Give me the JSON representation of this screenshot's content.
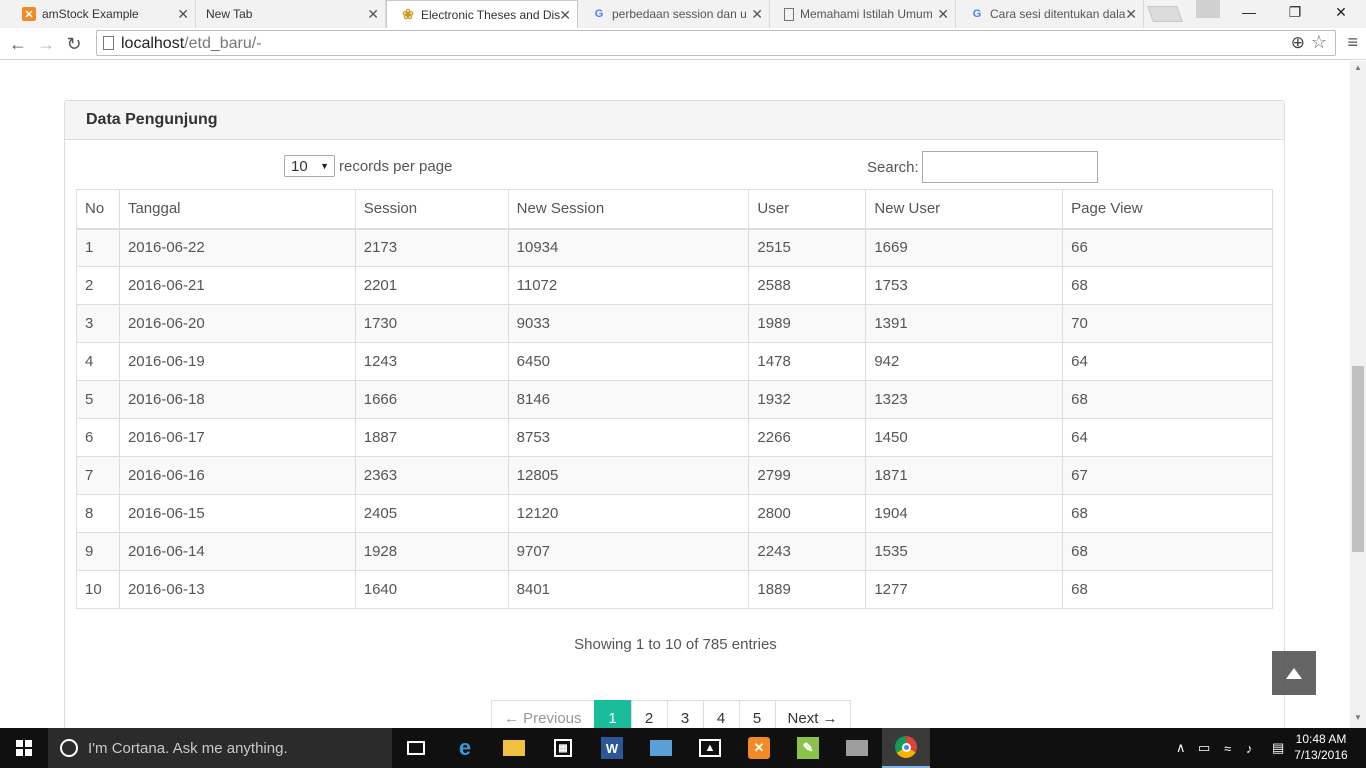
{
  "browser": {
    "tabs": [
      {
        "title": "amStock Example",
        "favicon": "xampp-icon",
        "active": false
      },
      {
        "title": "New Tab",
        "favicon": "",
        "active": false
      },
      {
        "title": "Electronic Theses and Dis",
        "favicon": "crest-icon",
        "active": true
      },
      {
        "title": "perbedaan session dan u",
        "favicon": "google-icon",
        "active": false
      },
      {
        "title": "Memahami Istilah Umum",
        "favicon": "page-icon",
        "active": false
      },
      {
        "title": "Cara sesi ditentukan dala",
        "favicon": "google-icon",
        "active": false
      }
    ],
    "url_host": "localhost",
    "url_path": "/etd_baru/-"
  },
  "panel": {
    "title": "Data Pengunjung",
    "length_value": "10",
    "length_label": "records per page",
    "search_label": "Search:",
    "search_value": ""
  },
  "table": {
    "headers": [
      "No",
      "Tanggal",
      "Session",
      "New Session",
      "User",
      "New User",
      "Page View"
    ],
    "rows": [
      [
        "1",
        "2016-06-22",
        "2173",
        "10934",
        "2515",
        "1669",
        "66"
      ],
      [
        "2",
        "2016-06-21",
        "2201",
        "11072",
        "2588",
        "1753",
        "68"
      ],
      [
        "3",
        "2016-06-20",
        "1730",
        "9033",
        "1989",
        "1391",
        "70"
      ],
      [
        "4",
        "2016-06-19",
        "1243",
        "6450",
        "1478",
        "942",
        "64"
      ],
      [
        "5",
        "2016-06-18",
        "1666",
        "8146",
        "1932",
        "1323",
        "68"
      ],
      [
        "6",
        "2016-06-17",
        "1887",
        "8753",
        "2266",
        "1450",
        "64"
      ],
      [
        "7",
        "2016-06-16",
        "2363",
        "12805",
        "2799",
        "1871",
        "67"
      ],
      [
        "8",
        "2016-06-15",
        "2405",
        "12120",
        "2800",
        "1904",
        "68"
      ],
      [
        "9",
        "2016-06-14",
        "1928",
        "9707",
        "2243",
        "1535",
        "68"
      ],
      [
        "10",
        "2016-06-13",
        "1640",
        "8401",
        "1889",
        "1277",
        "68"
      ]
    ]
  },
  "info": "Showing 1 to 10 of 785 entries",
  "pagination": {
    "previous": "← Previous",
    "pages": [
      "1",
      "2",
      "3",
      "4",
      "5"
    ],
    "active_page": "1",
    "next": "Next →"
  },
  "taskbar": {
    "cortana_placeholder": "I'm Cortana. Ask me anything.",
    "time": "10:48 AM",
    "date": "7/13/2016"
  },
  "colors": {
    "accent": "#1abc9c",
    "taskbar": "#101010"
  }
}
